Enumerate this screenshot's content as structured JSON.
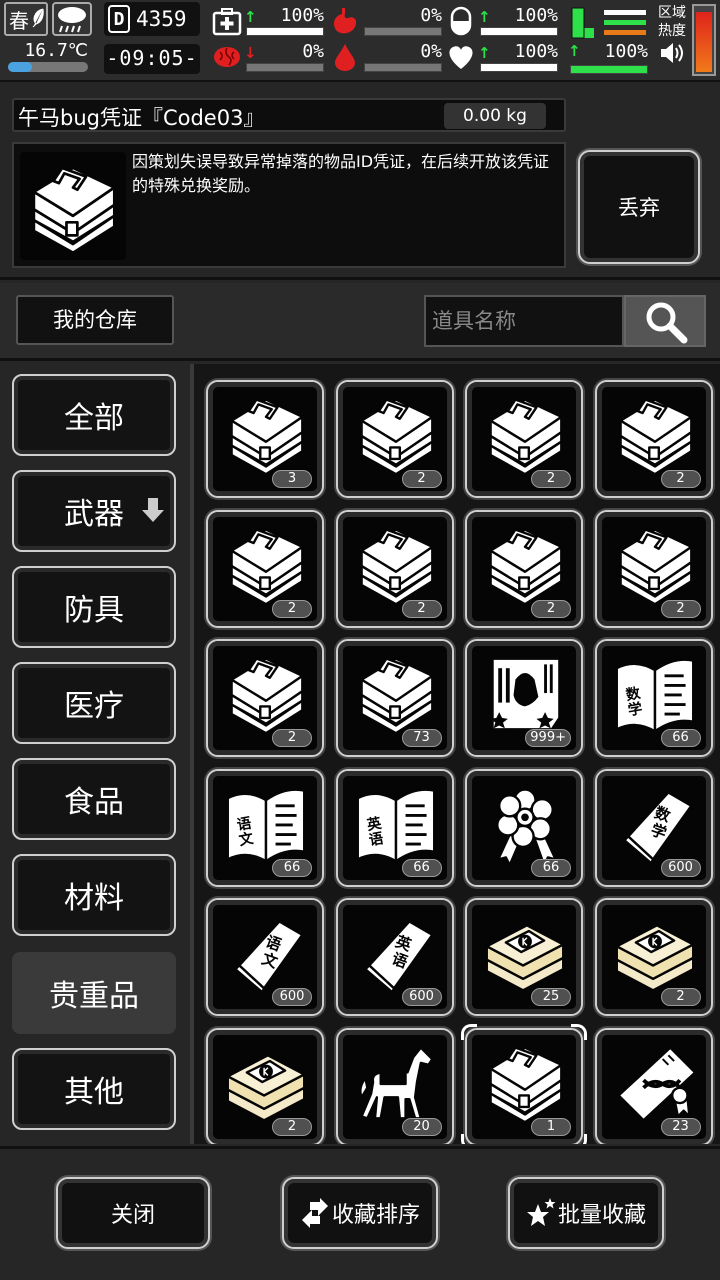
{
  "status": {
    "season": "春",
    "temperature": "16.7℃",
    "day": "4359",
    "time": "-09:05-",
    "stats": [
      {
        "name": "health",
        "icon": "medkit-icon",
        "trend": "up",
        "value": "100%",
        "level": 1.0,
        "color": "#ffffff"
      },
      {
        "name": "hunger",
        "icon": "stomach-icon",
        "trend": "",
        "value": "0%",
        "level": 0.0,
        "color": "#ffffff"
      },
      {
        "name": "thirst",
        "icon": "water-drop-icon",
        "trend": "",
        "value": "0%",
        "level": 0.0,
        "color": "#ffffff"
      },
      {
        "name": "brain",
        "icon": "brain-icon",
        "trend": "down",
        "value": "0%",
        "level": 0.0,
        "color": "#ffffff"
      },
      {
        "name": "stamina",
        "icon": "pill-icon",
        "trend": "up",
        "value": "100%",
        "level": 1.0,
        "color": "#ffffff"
      },
      {
        "name": "mood",
        "icon": "heart-icon",
        "trend": "up",
        "value": "100%",
        "level": 1.0,
        "color": "#ffffff"
      },
      {
        "name": "energy",
        "icon": "boot-icon",
        "trend": "up",
        "value": "100%",
        "level": 1.0,
        "color": "#2ee04a"
      }
    ],
    "region_label": "区域热度"
  },
  "detail": {
    "item_name": "午马bug凭证『Code03』",
    "weight": "0.00 kg",
    "description": "因策划失误导致异常掉落的物品ID凭证，在后续开放该凭证的特殊兑换奖励。",
    "discard_label": "丢弃"
  },
  "warehouse": {
    "title": "我的仓库",
    "search_placeholder": "道具名称"
  },
  "categories": [
    {
      "label": "全部",
      "active": false
    },
    {
      "label": "武器",
      "active": false,
      "has_arrow": true
    },
    {
      "label": "防具",
      "active": false
    },
    {
      "label": "医疗",
      "active": false
    },
    {
      "label": "食品",
      "active": false
    },
    {
      "label": "材料",
      "active": false
    },
    {
      "label": "贵重品",
      "active": true
    },
    {
      "label": "其他",
      "active": false
    }
  ],
  "items": [
    {
      "icon": "briefcase-icon",
      "count": "3"
    },
    {
      "icon": "briefcase-icon",
      "count": "2"
    },
    {
      "icon": "briefcase-icon",
      "count": "2"
    },
    {
      "icon": "briefcase-icon",
      "count": "2"
    },
    {
      "icon": "briefcase-icon",
      "count": "2"
    },
    {
      "icon": "briefcase-icon",
      "count": "2"
    },
    {
      "icon": "briefcase-icon",
      "count": "2"
    },
    {
      "icon": "briefcase-icon",
      "count": "2"
    },
    {
      "icon": "briefcase-icon",
      "count": "2"
    },
    {
      "icon": "briefcase-icon",
      "count": "73"
    },
    {
      "icon": "ticket-icon",
      "count": "999+"
    },
    {
      "icon": "math-book-open-icon",
      "count": "66",
      "text": "数学"
    },
    {
      "icon": "chinese-book-open-icon",
      "count": "66",
      "text": "语文"
    },
    {
      "icon": "english-book-open-icon",
      "count": "66",
      "text": "英语"
    },
    {
      "icon": "flower-medal-icon",
      "count": "66"
    },
    {
      "icon": "math-book-icon",
      "count": "600",
      "text": "数学"
    },
    {
      "icon": "chinese-book-icon",
      "count": "600",
      "text": "语文"
    },
    {
      "icon": "english-book-icon",
      "count": "600",
      "text": "英语"
    },
    {
      "icon": "yellow-box-icon",
      "count": "25"
    },
    {
      "icon": "yellow-box-icon",
      "count": "2"
    },
    {
      "icon": "yellow-box-icon",
      "count": "2"
    },
    {
      "icon": "horse-icon",
      "count": "20"
    },
    {
      "icon": "briefcase-icon",
      "count": "1",
      "selected": true
    },
    {
      "icon": "dna-card-icon",
      "count": "23"
    }
  ],
  "buttons": {
    "close": "关闭",
    "sort": "收藏排序",
    "batch": "批量收藏"
  }
}
